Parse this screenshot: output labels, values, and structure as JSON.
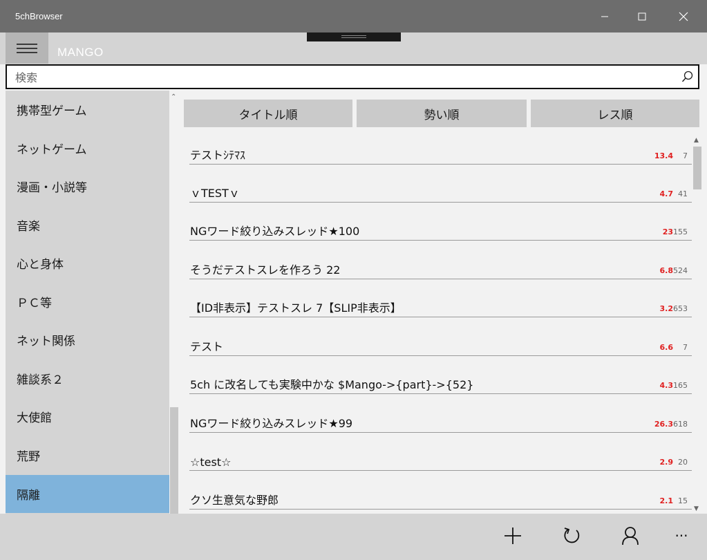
{
  "window": {
    "title": "5chBrowser"
  },
  "header": {
    "board_name": "MANGO"
  },
  "search": {
    "placeholder": "検索"
  },
  "sidebar": {
    "items": [
      {
        "label": "携帯型ゲーム",
        "selected": false
      },
      {
        "label": "ネットゲーム",
        "selected": false
      },
      {
        "label": "漫画・小説等",
        "selected": false
      },
      {
        "label": "音楽",
        "selected": false
      },
      {
        "label": "心と身体",
        "selected": false
      },
      {
        "label": "ＰＣ等",
        "selected": false
      },
      {
        "label": "ネット関係",
        "selected": false
      },
      {
        "label": "雑談系２",
        "selected": false
      },
      {
        "label": "大使館",
        "selected": false
      },
      {
        "label": "荒野",
        "selected": false
      },
      {
        "label": "隔離",
        "selected": true
      }
    ],
    "selected_color": "#7fb3db"
  },
  "sort_buttons": [
    {
      "label": "タイトル順"
    },
    {
      "label": "勢い順"
    },
    {
      "label": "レス順"
    }
  ],
  "threads": [
    {
      "title": "テストｼﾃﾏｽ",
      "momentum": "13.4",
      "count": "7"
    },
    {
      "title": "ｖTESTｖ",
      "momentum": "4.7",
      "count": "41"
    },
    {
      "title": "NGワード絞り込みスレッド★100",
      "momentum": "23",
      "count": "155"
    },
    {
      "title": "そうだテストスレを作ろう 22",
      "momentum": "6.8",
      "count": "524"
    },
    {
      "title": "【ID非表示】テストスレ 7【SLIP非表示】",
      "momentum": "3.2",
      "count": "653"
    },
    {
      "title": "テスト",
      "momentum": "6.6",
      "count": "7"
    },
    {
      "title": "5ch に改名しても実験中かな $Mango->{part}->{52}",
      "momentum": "4.3",
      "count": "165"
    },
    {
      "title": "NGワード絞り込みスレッド★99",
      "momentum": "26.3",
      "count": "618"
    },
    {
      "title": "☆test☆",
      "momentum": "2.9",
      "count": "20"
    },
    {
      "title": "クソ生意気な野郎",
      "momentum": "2.1",
      "count": "15"
    }
  ],
  "bottom_bar": {
    "buttons": [
      "plus-icon",
      "refresh-icon",
      "user-icon",
      "more-icon"
    ],
    "more_label": "···"
  },
  "colors": {
    "momentum": "#e02020",
    "titlebar": "#6d6d6d",
    "accent": "#7fb3db"
  }
}
